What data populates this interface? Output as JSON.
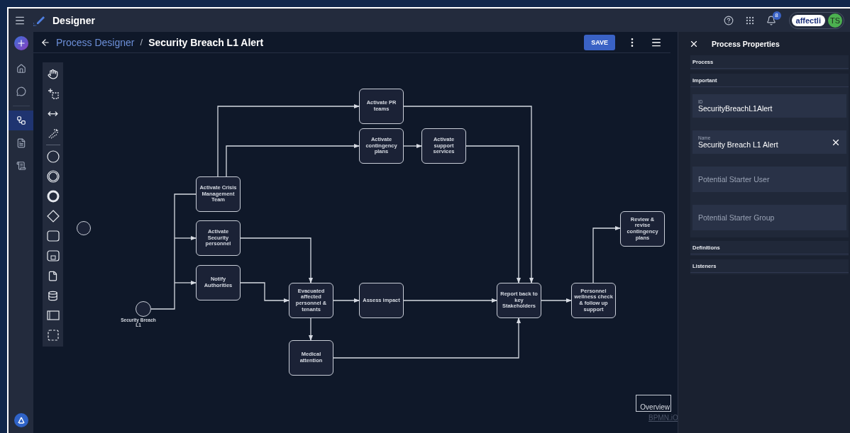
{
  "app": {
    "title": "Designer"
  },
  "topbar": {
    "notification_count": "8",
    "brand": "affectli",
    "avatar_initials": "TS"
  },
  "nav": {
    "items": [
      {
        "kind": "home",
        "selected": false
      },
      {
        "kind": "chat",
        "selected": false
      },
      {
        "kind": "process",
        "selected": true
      },
      {
        "kind": "form",
        "selected": false
      },
      {
        "kind": "script",
        "selected": false
      }
    ]
  },
  "breadcrumb": {
    "parent": "Process Designer",
    "separator": "/",
    "current": "Security Breach L1 Alert"
  },
  "toolbar": {
    "save": "SAVE"
  },
  "diagram": {
    "nodes": [
      {
        "kind": "start",
        "label": "Security Breach L1"
      },
      {
        "kind": "event"
      },
      {
        "kind": "task",
        "label": "Activate PR teams"
      },
      {
        "kind": "task",
        "label": "Activate contingency plans"
      },
      {
        "kind": "task",
        "label": "Activate support services"
      },
      {
        "kind": "task",
        "label": "Activate Crisis Management Team"
      },
      {
        "kind": "task",
        "label": "Activate Security personnel"
      },
      {
        "kind": "task",
        "label": "Notify Authorities"
      },
      {
        "kind": "task",
        "label": "Evacuated affected personnel & tenants"
      },
      {
        "kind": "task",
        "label": "Assess impact"
      },
      {
        "kind": "task",
        "label": "Medical attention"
      },
      {
        "kind": "task",
        "label": "Report back to key Stakeholders"
      },
      {
        "kind": "task",
        "label": "Personnel wellness check & follow up support"
      },
      {
        "kind": "task",
        "label": "Review & revise contingency plans"
      }
    ],
    "overview": "Overview",
    "watermark": "BPMN.iO"
  },
  "properties": {
    "title": "Process Properties",
    "sections": [
      {
        "title": "Process"
      },
      {
        "title": "Important",
        "fields": [
          {
            "label": "ID",
            "value": "SecurityBreachL1Alert",
            "clearable": false
          },
          {
            "label": "Name",
            "value": "Security Breach L1 Alert",
            "clearable": true
          },
          {
            "placeholder": "Potential Starter User",
            "clearable": false
          },
          {
            "placeholder": "Potential Starter Group",
            "clearable": false
          }
        ]
      },
      {
        "title": "Definitions"
      },
      {
        "title": "Listeners"
      }
    ]
  }
}
